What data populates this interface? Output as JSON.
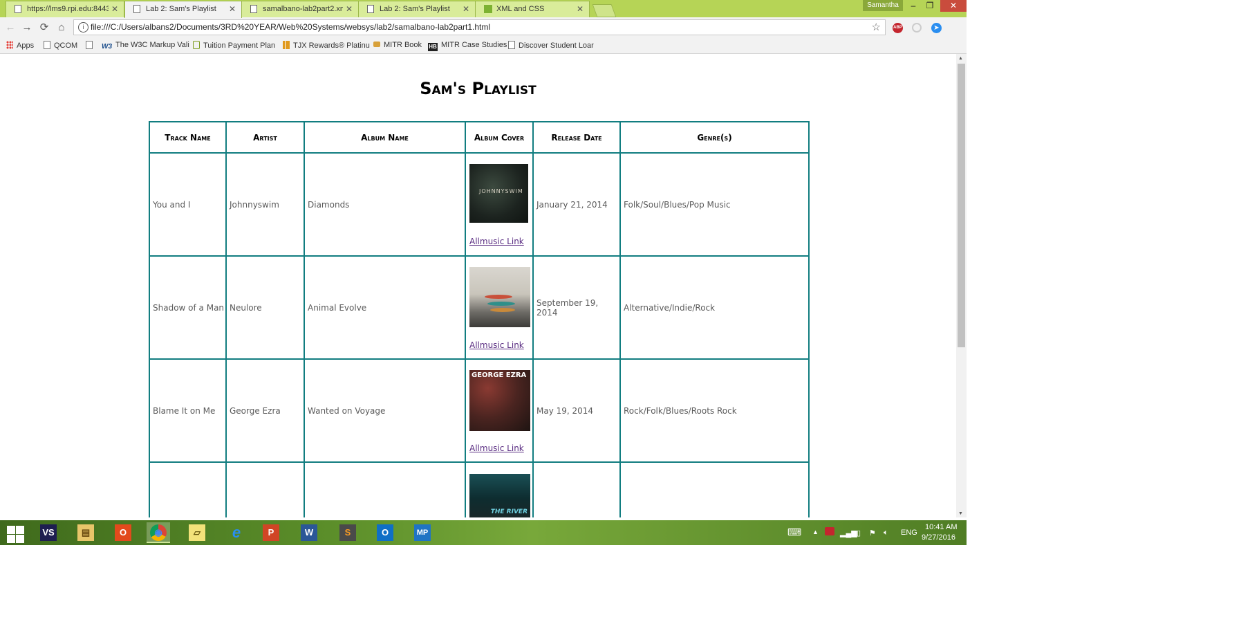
{
  "tabs": [
    {
      "title": "https://lms9.rpi.edu:8443",
      "active": false,
      "icon": "page-icon"
    },
    {
      "title": "Lab 2: Sam's Playlist",
      "active": true,
      "icon": "page-icon"
    },
    {
      "title": "samalbano-lab2part2.xml",
      "active": false,
      "icon": "page-icon"
    },
    {
      "title": "Lab 2: Sam's Playlist",
      "active": false,
      "icon": "page-icon"
    },
    {
      "title": "XML and CSS",
      "active": false,
      "icon": "xml-icon"
    }
  ],
  "window": {
    "user": "Samantha",
    "minimize": "–",
    "restore": "❐",
    "close": "✕"
  },
  "toolbar": {
    "back": "←",
    "forward": "→",
    "reload": "⟳",
    "home": "⌂",
    "url": "file:///C:/Users/albans2/Documents/3RD%20YEAR/Web%20Systems/websys/lab2/samalbano-lab2part1.html",
    "abp": "ABP",
    "menu": "⋮"
  },
  "bookmarks": [
    {
      "label": "Apps",
      "icon": "apps-icon"
    },
    {
      "label": "QCOM",
      "icon": "page-icon"
    },
    {
      "label": "",
      "icon": "page-icon"
    },
    {
      "label": "The W3C Markup Vali",
      "icon": "w3c-icon"
    },
    {
      "label": "Tuition Payment Plan",
      "icon": "tuition-icon"
    },
    {
      "label": "TJX Rewards® Platinu",
      "icon": "tjx-icon"
    },
    {
      "label": "MITR Book",
      "icon": "mitr-icon"
    },
    {
      "label": "MITR Case Studies",
      "icon": "hb-icon"
    },
    {
      "label": "Discover Student Loar",
      "icon": "page-icon"
    }
  ],
  "page": {
    "title": "Sam's Playlist",
    "columns": [
      "Track Name",
      "Artist",
      "Album Name",
      "Album Cover",
      "Release Date",
      "Genre(s)"
    ],
    "rows": [
      {
        "track": "You and I",
        "artist": "Johnnyswim",
        "album": "Diamonds",
        "cover_text": "JOHNNYSWIM",
        "link": "Allmusic Link",
        "date": "January 21, 2014",
        "genre": "Folk/Soul/Blues/Pop Music"
      },
      {
        "track": "Shadow of a Man",
        "artist": "Neulore",
        "album": "Animal Evolve",
        "cover_text": "",
        "link": "Allmusic Link",
        "date": "September 19, 2014",
        "genre": "Alternative/Indie/Rock"
      },
      {
        "track": "Blame It on Me",
        "artist": "George Ezra",
        "album": "Wanted on Voyage",
        "cover_text": "GEORGE EZRA",
        "link": "Allmusic Link",
        "date": "May 19, 2014",
        "genre": "Rock/Folk/Blues/Roots Rock"
      },
      {
        "track": "",
        "artist": "",
        "album": "",
        "cover_text": "THE RIVER",
        "link": "",
        "date": "",
        "genre": ""
      }
    ]
  },
  "taskbar": {
    "apps": [
      {
        "name": "visual-studio",
        "glyph": "VS"
      },
      {
        "name": "file-explorer",
        "glyph": "▤"
      },
      {
        "name": "office-app",
        "glyph": "O"
      },
      {
        "name": "chrome",
        "glyph": "◉"
      },
      {
        "name": "sticky-notes",
        "glyph": "▱"
      },
      {
        "name": "internet-explorer",
        "glyph": "e"
      },
      {
        "name": "powerpoint",
        "glyph": "P"
      },
      {
        "name": "word",
        "glyph": "W"
      },
      {
        "name": "sublime-text",
        "glyph": "S"
      },
      {
        "name": "outlook",
        "glyph": "O"
      },
      {
        "name": "media-player",
        "glyph": "MP"
      }
    ],
    "language": "ENG",
    "time": "10:41 AM",
    "date": "9/27/2016"
  }
}
